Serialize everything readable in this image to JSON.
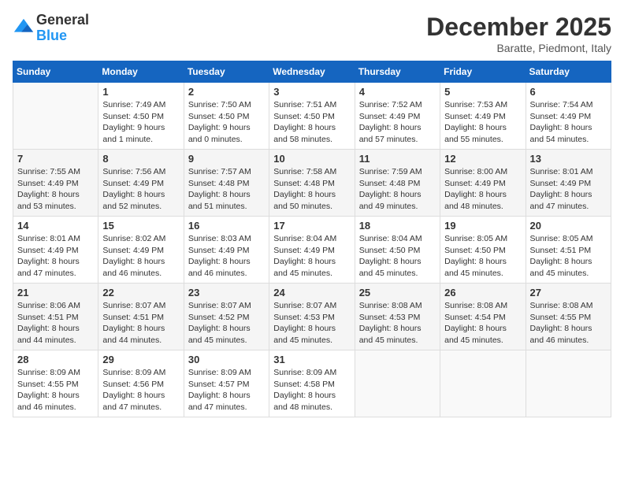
{
  "logo": {
    "general": "General",
    "blue": "Blue"
  },
  "title": {
    "month_year": "December 2025",
    "location": "Baratte, Piedmont, Italy"
  },
  "days_of_week": [
    "Sunday",
    "Monday",
    "Tuesday",
    "Wednesday",
    "Thursday",
    "Friday",
    "Saturday"
  ],
  "weeks": [
    [
      {
        "day": "",
        "info": ""
      },
      {
        "day": "1",
        "info": "Sunrise: 7:49 AM\nSunset: 4:50 PM\nDaylight: 9 hours\nand 1 minute."
      },
      {
        "day": "2",
        "info": "Sunrise: 7:50 AM\nSunset: 4:50 PM\nDaylight: 9 hours\nand 0 minutes."
      },
      {
        "day": "3",
        "info": "Sunrise: 7:51 AM\nSunset: 4:50 PM\nDaylight: 8 hours\nand 58 minutes."
      },
      {
        "day": "4",
        "info": "Sunrise: 7:52 AM\nSunset: 4:49 PM\nDaylight: 8 hours\nand 57 minutes."
      },
      {
        "day": "5",
        "info": "Sunrise: 7:53 AM\nSunset: 4:49 PM\nDaylight: 8 hours\nand 55 minutes."
      },
      {
        "day": "6",
        "info": "Sunrise: 7:54 AM\nSunset: 4:49 PM\nDaylight: 8 hours\nand 54 minutes."
      }
    ],
    [
      {
        "day": "7",
        "info": "Sunrise: 7:55 AM\nSunset: 4:49 PM\nDaylight: 8 hours\nand 53 minutes."
      },
      {
        "day": "8",
        "info": "Sunrise: 7:56 AM\nSunset: 4:49 PM\nDaylight: 8 hours\nand 52 minutes."
      },
      {
        "day": "9",
        "info": "Sunrise: 7:57 AM\nSunset: 4:48 PM\nDaylight: 8 hours\nand 51 minutes."
      },
      {
        "day": "10",
        "info": "Sunrise: 7:58 AM\nSunset: 4:48 PM\nDaylight: 8 hours\nand 50 minutes."
      },
      {
        "day": "11",
        "info": "Sunrise: 7:59 AM\nSunset: 4:48 PM\nDaylight: 8 hours\nand 49 minutes."
      },
      {
        "day": "12",
        "info": "Sunrise: 8:00 AM\nSunset: 4:49 PM\nDaylight: 8 hours\nand 48 minutes."
      },
      {
        "day": "13",
        "info": "Sunrise: 8:01 AM\nSunset: 4:49 PM\nDaylight: 8 hours\nand 47 minutes."
      }
    ],
    [
      {
        "day": "14",
        "info": "Sunrise: 8:01 AM\nSunset: 4:49 PM\nDaylight: 8 hours\nand 47 minutes."
      },
      {
        "day": "15",
        "info": "Sunrise: 8:02 AM\nSunset: 4:49 PM\nDaylight: 8 hours\nand 46 minutes."
      },
      {
        "day": "16",
        "info": "Sunrise: 8:03 AM\nSunset: 4:49 PM\nDaylight: 8 hours\nand 46 minutes."
      },
      {
        "day": "17",
        "info": "Sunrise: 8:04 AM\nSunset: 4:49 PM\nDaylight: 8 hours\nand 45 minutes."
      },
      {
        "day": "18",
        "info": "Sunrise: 8:04 AM\nSunset: 4:50 PM\nDaylight: 8 hours\nand 45 minutes."
      },
      {
        "day": "19",
        "info": "Sunrise: 8:05 AM\nSunset: 4:50 PM\nDaylight: 8 hours\nand 45 minutes."
      },
      {
        "day": "20",
        "info": "Sunrise: 8:05 AM\nSunset: 4:51 PM\nDaylight: 8 hours\nand 45 minutes."
      }
    ],
    [
      {
        "day": "21",
        "info": "Sunrise: 8:06 AM\nSunset: 4:51 PM\nDaylight: 8 hours\nand 44 minutes."
      },
      {
        "day": "22",
        "info": "Sunrise: 8:07 AM\nSunset: 4:51 PM\nDaylight: 8 hours\nand 44 minutes."
      },
      {
        "day": "23",
        "info": "Sunrise: 8:07 AM\nSunset: 4:52 PM\nDaylight: 8 hours\nand 45 minutes."
      },
      {
        "day": "24",
        "info": "Sunrise: 8:07 AM\nSunset: 4:53 PM\nDaylight: 8 hours\nand 45 minutes."
      },
      {
        "day": "25",
        "info": "Sunrise: 8:08 AM\nSunset: 4:53 PM\nDaylight: 8 hours\nand 45 minutes."
      },
      {
        "day": "26",
        "info": "Sunrise: 8:08 AM\nSunset: 4:54 PM\nDaylight: 8 hours\nand 45 minutes."
      },
      {
        "day": "27",
        "info": "Sunrise: 8:08 AM\nSunset: 4:55 PM\nDaylight: 8 hours\nand 46 minutes."
      }
    ],
    [
      {
        "day": "28",
        "info": "Sunrise: 8:09 AM\nSunset: 4:55 PM\nDaylight: 8 hours\nand 46 minutes."
      },
      {
        "day": "29",
        "info": "Sunrise: 8:09 AM\nSunset: 4:56 PM\nDaylight: 8 hours\nand 47 minutes."
      },
      {
        "day": "30",
        "info": "Sunrise: 8:09 AM\nSunset: 4:57 PM\nDaylight: 8 hours\nand 47 minutes."
      },
      {
        "day": "31",
        "info": "Sunrise: 8:09 AM\nSunset: 4:58 PM\nDaylight: 8 hours\nand 48 minutes."
      },
      {
        "day": "",
        "info": ""
      },
      {
        "day": "",
        "info": ""
      },
      {
        "day": "",
        "info": ""
      }
    ]
  ]
}
